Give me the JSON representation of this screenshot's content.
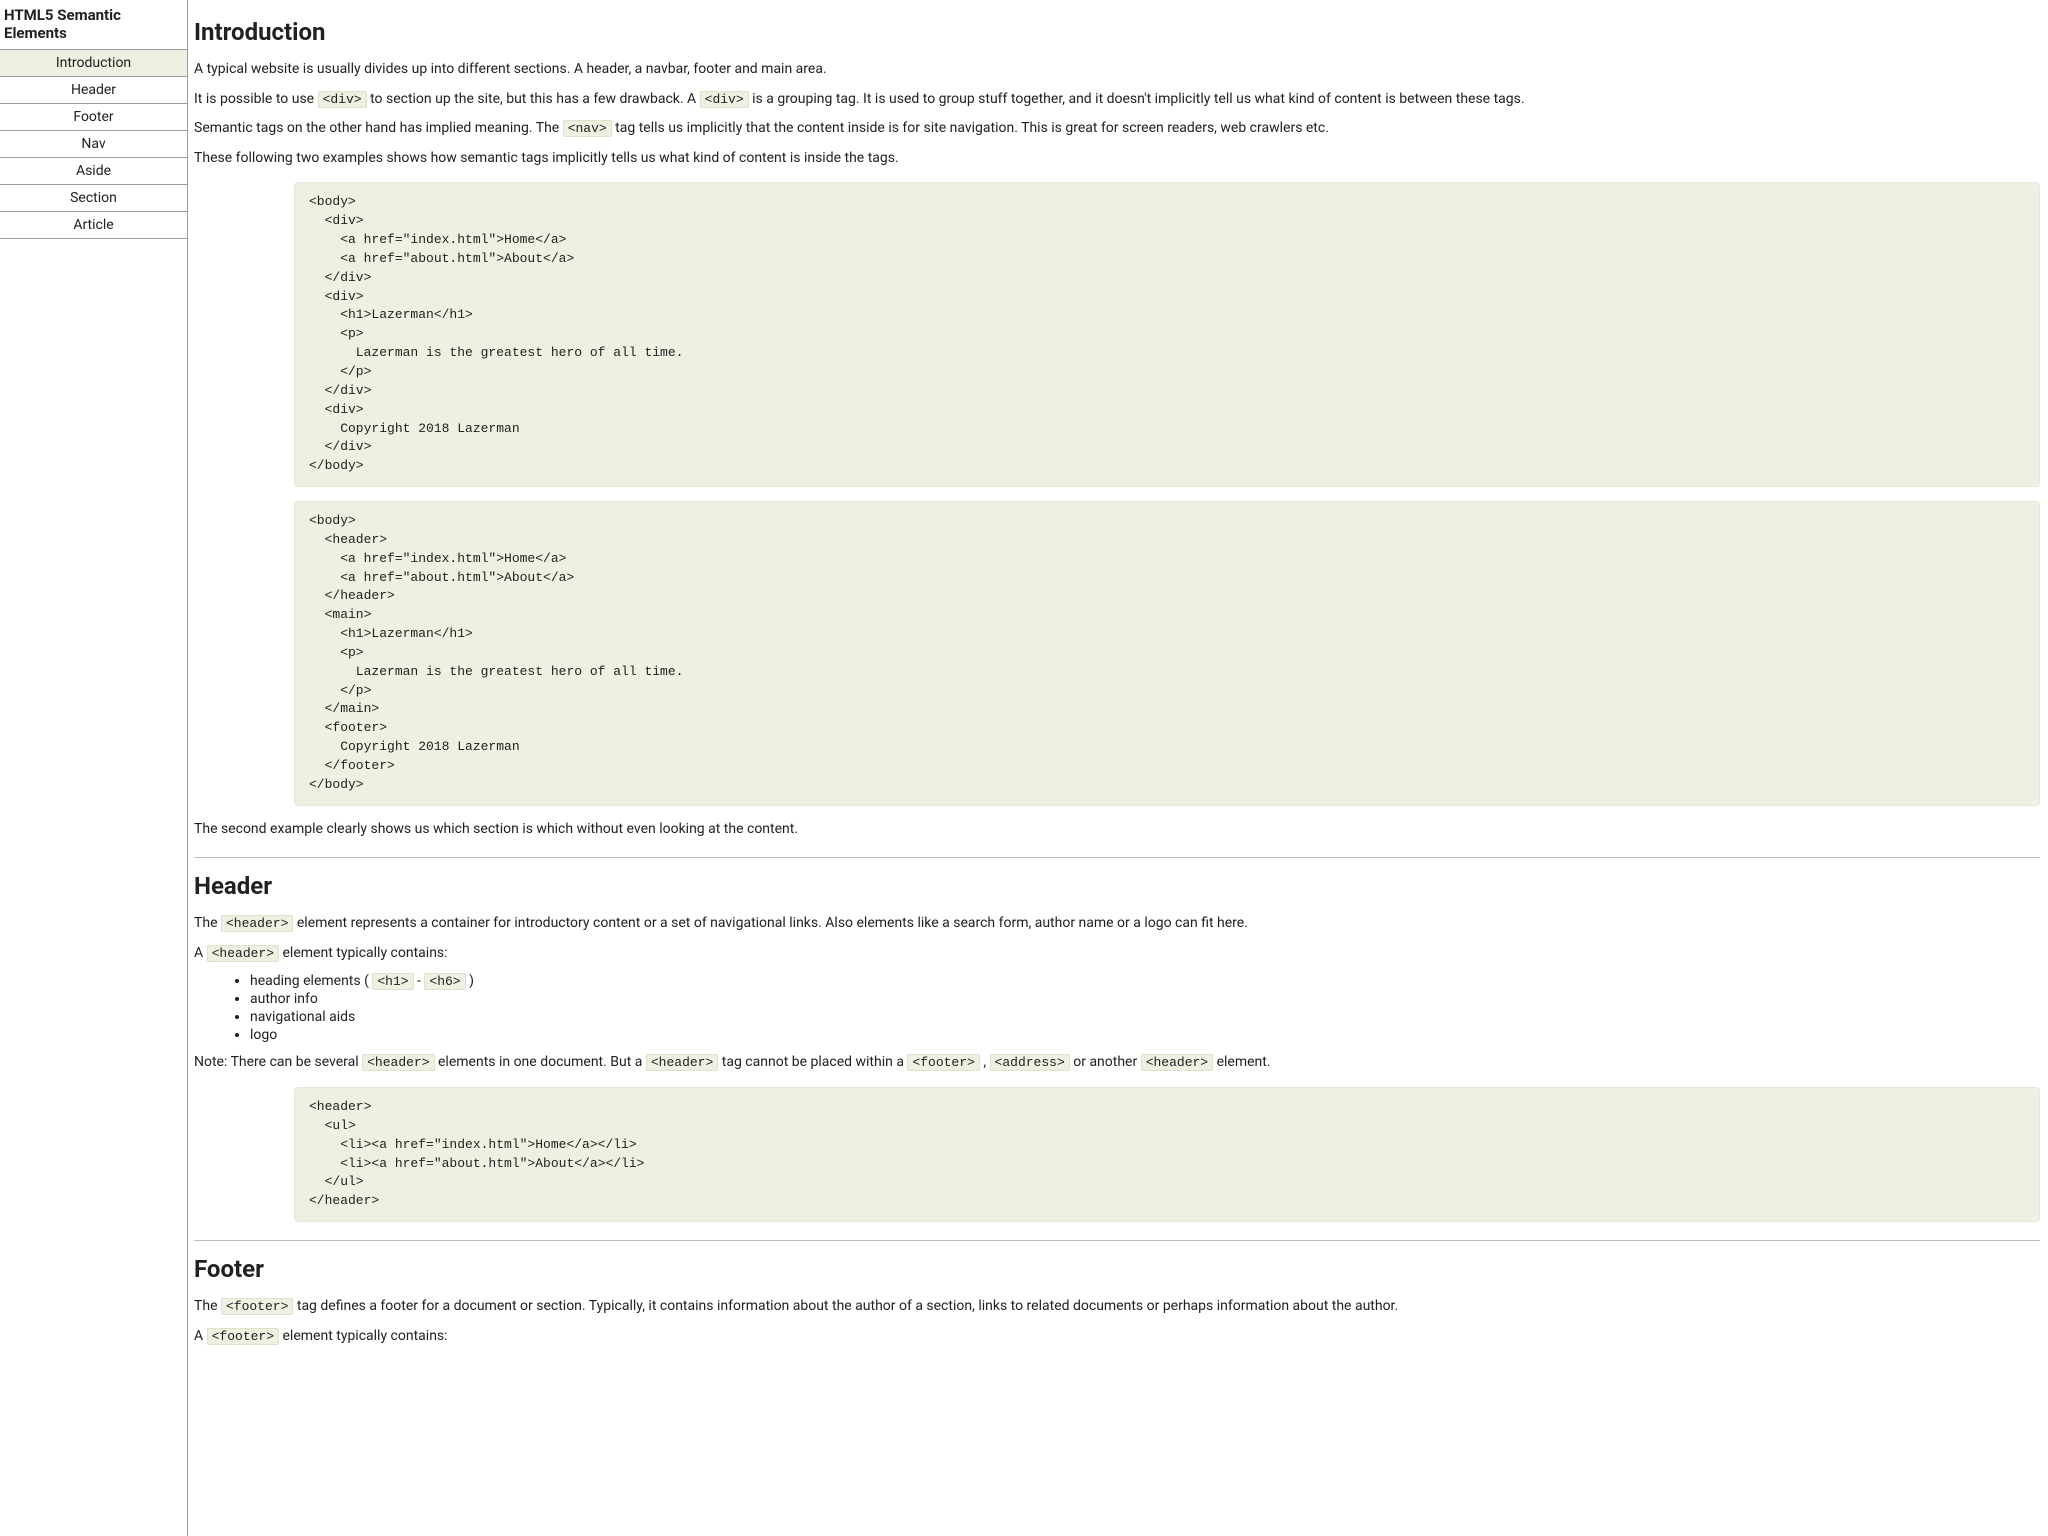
{
  "sidebar": {
    "title": "HTML5 Semantic Elements",
    "items": [
      {
        "label": "Introduction",
        "active": true
      },
      {
        "label": "Header",
        "active": false
      },
      {
        "label": "Footer",
        "active": false
      },
      {
        "label": "Nav",
        "active": false
      },
      {
        "label": "Aside",
        "active": false
      },
      {
        "label": "Section",
        "active": false
      },
      {
        "label": "Article",
        "active": false
      }
    ]
  },
  "intro": {
    "heading": "Introduction",
    "p1": "A typical website is usually divides up into different sections. A header, a navbar, footer and main area.",
    "p2a": "It is possible to use ",
    "p2code1": "<div>",
    "p2b": " to section up the site, but this has a few drawback. A ",
    "p2code2": "<div>",
    "p2c": " is a grouping tag. It is used to group stuff together, and it doesn't implicitly tell us what kind of content is between these tags.",
    "p3a": "Semantic tags on the other hand has implied meaning. The ",
    "p3code": "<nav>",
    "p3b": " tag tells us implicitly that the content inside is for site navigation. This is great for screen readers, web crawlers etc.",
    "p4": "These following two examples shows how semantic tags implicitly tells us what kind of content is inside the tags.",
    "code1": "<body>\n  <div>\n    <a href=\"index.html\">Home</a>\n    <a href=\"about.html\">About</a>\n  </div>\n  <div>\n    <h1>Lazerman</h1>\n    <p>\n      Lazerman is the greatest hero of all time.\n    </p>\n  </div>\n  <div>\n    Copyright 2018 Lazerman\n  </div>\n</body>",
    "code2": "<body>\n  <header>\n    <a href=\"index.html\">Home</a>\n    <a href=\"about.html\">About</a>\n  </header>\n  <main>\n    <h1>Lazerman</h1>\n    <p>\n      Lazerman is the greatest hero of all time.\n    </p>\n  </main>\n  <footer>\n    Copyright 2018 Lazerman\n  </footer>\n</body>",
    "p5": "The second example clearly shows us which section is which without even looking at the content."
  },
  "header_section": {
    "heading": "Header",
    "p1a": "The ",
    "p1code": "<header>",
    "p1b": " element represents a container for introductory content or a set of navigational links. Also elements like a search form, author name or a logo can fit here.",
    "p2a": "A ",
    "p2code": "<header>",
    "p2b": " element typically contains:",
    "li1a": "heading elements ( ",
    "li1code1": "<h1>",
    "li1dash": " - ",
    "li1code2": "<h6>",
    "li1b": " )",
    "li2": "author info",
    "li3": "navigational aids",
    "li4": "logo",
    "p3a": "Note: There can be several ",
    "p3code1": "<header>",
    "p3b": " elements in one document. But a ",
    "p3code2": "<header>",
    "p3c": " tag cannot be placed within a ",
    "p3code3": "<footer>",
    "p3d": " , ",
    "p3code4": "<address>",
    "p3e": " or another ",
    "p3code5": "<header>",
    "p3f": " element.",
    "code": "<header>\n  <ul>\n    <li><a href=\"index.html\">Home</a></li>\n    <li><a href=\"about.html\">About</a></li>\n  </ul>\n</header>"
  },
  "footer_section": {
    "heading": "Footer",
    "p1a": "The ",
    "p1code": "<footer>",
    "p1b": " tag defines a footer for a document or section. Typically, it contains information about the author of a section, links to related documents or perhaps information about the author.",
    "p2a": "A ",
    "p2code": "<footer>",
    "p2b": " element typically contains:"
  }
}
